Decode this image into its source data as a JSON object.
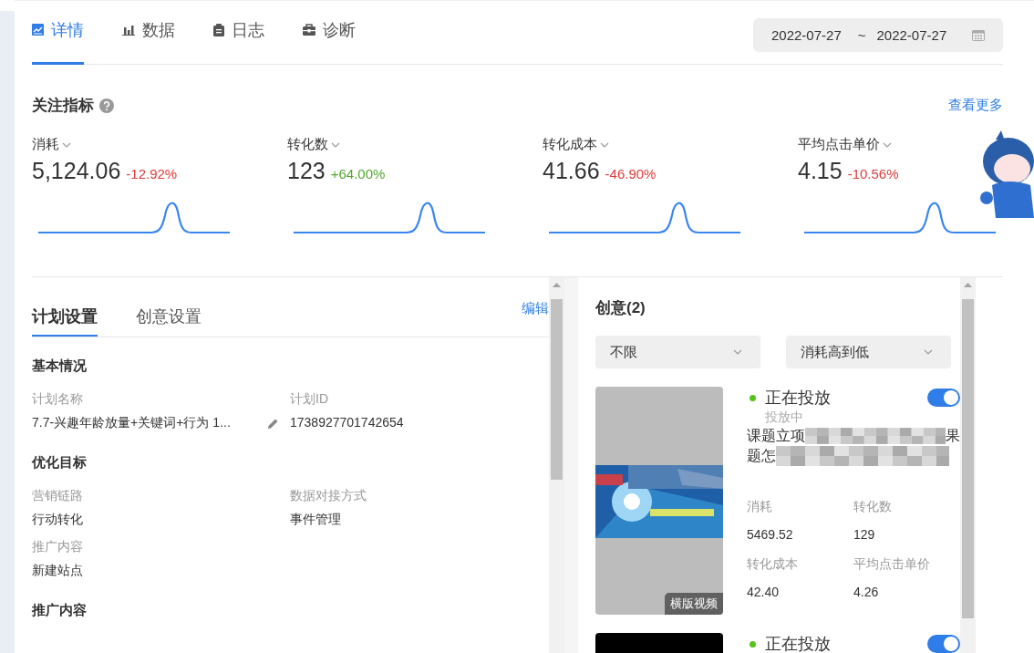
{
  "tabs": [
    {
      "label": "详情",
      "selected": true
    },
    {
      "label": "数据",
      "selected": false
    },
    {
      "label": "日志",
      "selected": false
    },
    {
      "label": "诊断",
      "selected": false
    }
  ],
  "date_range": {
    "start": "2022-07-27",
    "separator": "~",
    "end": "2022-07-27"
  },
  "metrics_section": {
    "title": "关注指标",
    "more_link": "查看更多"
  },
  "metrics": [
    {
      "label": "消耗",
      "value": "5,124.06",
      "change": "-12.92%",
      "color": "#e03a3a"
    },
    {
      "label": "转化数",
      "value": "123",
      "change": "+64.00%",
      "color": "#52a82c"
    },
    {
      "label": "转化成本",
      "value": "41.66",
      "change": "-46.90%",
      "color": "#e03a3a"
    },
    {
      "label": "平均点击单价",
      "value": "4.15",
      "change": "-10.56%",
      "color": "#e03a3a"
    }
  ],
  "settings": {
    "tabs": [
      {
        "label": "计划设置",
        "selected": true
      },
      {
        "label": "创意设置",
        "selected": false
      }
    ],
    "edit_link": "编辑",
    "sections": [
      {
        "title": "基本情况",
        "fields": [
          {
            "label": "计划名称",
            "value": "7.7-兴趣年龄放量+关键词+行为  1...",
            "editable": true
          },
          {
            "label": "计划ID",
            "value": "1738927701742654",
            "editable": false
          }
        ]
      },
      {
        "title": "优化目标",
        "fields": [
          {
            "label": "营销链路",
            "value": "行动转化",
            "editable": false
          },
          {
            "label": "数据对接方式",
            "value": "事件管理",
            "editable": false
          },
          {
            "label": "推广内容",
            "value": "新建站点",
            "editable": false
          }
        ]
      },
      {
        "title": "推广内容"
      }
    ]
  },
  "creatives": {
    "title": "创意(2)",
    "filters": [
      {
        "value": "不限"
      },
      {
        "value": "消耗高到低"
      }
    ],
    "items": [
      {
        "status": "正在投放",
        "color": "#52c41a",
        "on": true,
        "substatus": "投放中",
        "title_lines": [
          [
            "课题立项",
            "果"
          ],
          [
            "题怎"
          ]
        ],
        "kind": "picture",
        "badge": "横版视频",
        "stats": [
          {
            "label": "消耗",
            "value": "5469.52"
          },
          {
            "label": "转化数",
            "value": "129"
          },
          {
            "label": "转化成本",
            "value": "42.40"
          },
          {
            "label": "平均点击单价",
            "value": "4.26"
          }
        ]
      },
      {
        "status": "正在投放",
        "color": "#52c41a",
        "on": true,
        "kind": "video"
      }
    ]
  }
}
